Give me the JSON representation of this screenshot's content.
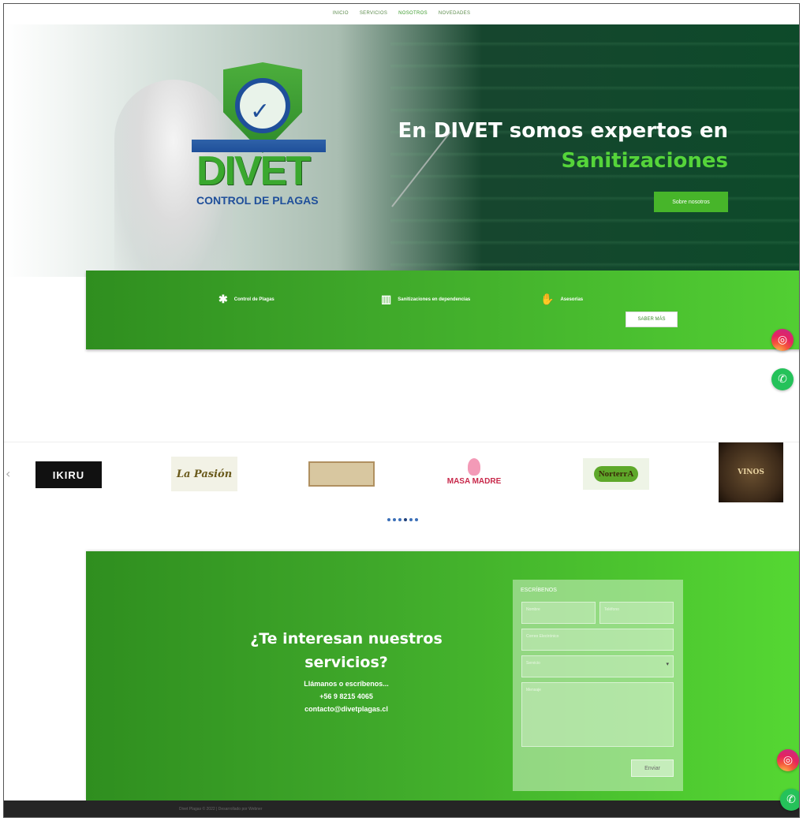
{
  "nav": {
    "items": [
      "INICIO",
      "SERVICIOS",
      "NOSOTROS",
      "NOVEDADES"
    ],
    "active_index": 2
  },
  "hero": {
    "logo_word": "DIVET",
    "logo_sub": "CONTROL DE PLAGAS",
    "title": "En DIVET somos expertos en",
    "accent": "Sanitizaciones",
    "button": "Sobre nosotros"
  },
  "services": {
    "items": [
      {
        "label": "Control de Plagas",
        "icon": "bug-icon"
      },
      {
        "label": "Sanitizaciones en dependencias",
        "icon": "building-icon"
      },
      {
        "label": "Asesorías",
        "icon": "handshake-icon"
      }
    ],
    "more_button": "SABER MÁS"
  },
  "clients": {
    "logos": [
      "IKIRU",
      "La Pasión",
      "",
      "MASA MADRE",
      "NorterrA",
      "VINOS"
    ],
    "active_dot": 3,
    "dot_count": 6
  },
  "contact": {
    "heading_line1": "¿Te interesan nuestros",
    "heading_line2": "servicios?",
    "call_line": "Llámanos o escríbenos...",
    "phone": "+56 9 8215 4065",
    "email": "contacto@divetplagas.cl",
    "form": {
      "title": "ESCRÍBENOS",
      "nombre_placeholder": "Nombre",
      "telefono_placeholder": "Teléfono",
      "correo_placeholder": "Correo Electrónico",
      "servicio_value": "Servicio",
      "mensaje_placeholder": "Mensaje",
      "submit": "Enviar"
    }
  },
  "footer": {
    "text": "Divet Plagas © 2022 | Desarrollado por Webner"
  },
  "colors": {
    "brand_green": "#47b52a",
    "accent_green": "#55d43a",
    "hero_dark": "#0d4a2a",
    "instagram": "#e6235f",
    "whatsapp": "#25c25a"
  }
}
